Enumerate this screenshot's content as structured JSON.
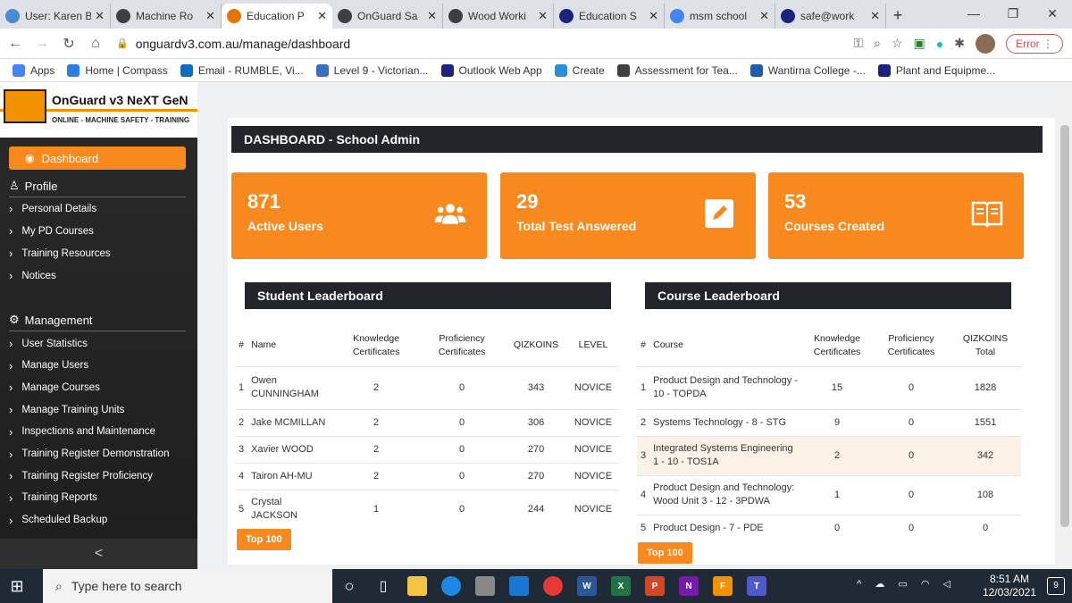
{
  "browser": {
    "tabs": [
      {
        "title": "User: Karen B",
        "color": "#4a8bd6"
      },
      {
        "title": "Machine Ro",
        "color": "#3c4043"
      },
      {
        "title": "Education P",
        "color": "#e37400",
        "active": true
      },
      {
        "title": "OnGuard Sa",
        "color": "#3c4043"
      },
      {
        "title": "Wood Worki",
        "color": "#3c4043"
      },
      {
        "title": "Education S",
        "color": "#1a237e"
      },
      {
        "title": "msm school",
        "color": "#4285f4"
      },
      {
        "title": "safe@work",
        "color": "#1a237e"
      }
    ],
    "url": "onguardv3.com.au/manage/dashboard",
    "error_label": "Error",
    "bookmarks": [
      {
        "label": "Apps",
        "color": "#4285f4"
      },
      {
        "label": "Home | Compass",
        "color": "#2a7de1"
      },
      {
        "label": "Email - RUMBLE, Vi...",
        "color": "#0f6cbd"
      },
      {
        "label": "Level 9 - Victorian...",
        "color": "#3a6fbf"
      },
      {
        "label": "Outlook Web App",
        "color": "#1a237e"
      },
      {
        "label": "Create",
        "color": "#2a8fd6"
      },
      {
        "label": "Assessment for Tea...",
        "color": "#3c4043"
      },
      {
        "label": "Wantirna College -...",
        "color": "#1e5ba8"
      },
      {
        "label": "Plant and Equipme...",
        "color": "#1a237e"
      }
    ]
  },
  "sidebar": {
    "brand_title": "OnGuard v3 NeXT GeN",
    "brand_subtitle": "ONLINE - MACHINE SAFETY - TRAINING",
    "dashboard": "Dashboard",
    "profile_head": "Profile",
    "profile_items": [
      "Personal Details",
      "My PD Courses",
      "Training Resources",
      "Notices"
    ],
    "management_head": "Management",
    "management_items": [
      "User Statistics",
      "Manage Users",
      "Manage Courses",
      "Manage Training Units",
      "Inspections and Maintenance",
      "Training Register Demonstration",
      "Training Register Proficiency",
      "Training Reports",
      "Scheduled Backup"
    ],
    "collapse": "<"
  },
  "main": {
    "title": "DASHBOARD - School Admin",
    "stats": [
      {
        "value": "871",
        "label": "Active Users",
        "icon": "users-icon"
      },
      {
        "value": "29",
        "label": "Total Test Answered",
        "icon": "edit-icon"
      },
      {
        "value": "53",
        "label": "Courses Created",
        "icon": "book-icon"
      }
    ],
    "student_leaderboard": {
      "title": "Student Leaderboard",
      "headers": [
        "#",
        "Name",
        "Knowledge Certificates",
        "Proficiency Certificates",
        "QIZKOINS",
        "LEVEL"
      ],
      "rows": [
        [
          "1",
          "Owen CUNNINGHAM",
          "2",
          "0",
          "343",
          "NOVICE"
        ],
        [
          "2",
          "Jake MCMILLAN",
          "2",
          "0",
          "306",
          "NOVICE"
        ],
        [
          "3",
          "Xavier WOOD",
          "2",
          "0",
          "270",
          "NOVICE"
        ],
        [
          "4",
          "Tairon AH-MU",
          "2",
          "0",
          "270",
          "NOVICE"
        ],
        [
          "5",
          "Crystal JACKSON",
          "1",
          "0",
          "244",
          "NOVICE"
        ]
      ],
      "button": "Top 100"
    },
    "course_leaderboard": {
      "title": "Course Leaderboard",
      "headers": [
        "#",
        "Course",
        "Knowledge Certificates",
        "Proficiency Certificates",
        "QIZKOINS Total"
      ],
      "rows": [
        [
          "1",
          "Product Design and Technology - 10 - TOPDA",
          "15",
          "0",
          "1828"
        ],
        [
          "2",
          "Systems Technology - 8 - STG",
          "9",
          "0",
          "1551"
        ],
        [
          "3",
          "Integrated Systems Engineering 1 - 10 - TOS1A",
          "2",
          "0",
          "342"
        ],
        [
          "4",
          "Product Design and Technology: Wood Unit 3 - 12 - 3PDWA",
          "1",
          "0",
          "108"
        ],
        [
          "5",
          "Product Design - 7 - PDE",
          "0",
          "0",
          "0"
        ]
      ],
      "button": "Top 100"
    }
  },
  "taskbar": {
    "search_placeholder": "Type here to search",
    "time": "8:51 AM",
    "date": "12/03/2021",
    "notifications": "9"
  }
}
